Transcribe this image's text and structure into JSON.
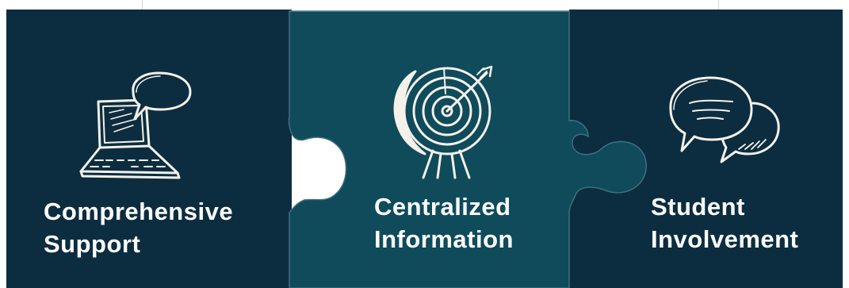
{
  "pieces": [
    {
      "line1": "Comprehensive",
      "line2": "Support",
      "icon": "laptop-chat-icon",
      "color": "#0c2d40"
    },
    {
      "line1": "Centralized",
      "line2": "Information",
      "icon": "target-arrow-icon",
      "color": "#0f4b5b"
    },
    {
      "line1": "Student",
      "line2": "Involvement",
      "icon": "speech-bubbles-icon",
      "color": "#0c2d40"
    }
  ],
  "colors": {
    "dark_piece": "#0c2d40",
    "teal_piece": "#0f4b5b",
    "sketch_stroke": "#f4f1ea",
    "piece_edge": "#3f6e82"
  }
}
